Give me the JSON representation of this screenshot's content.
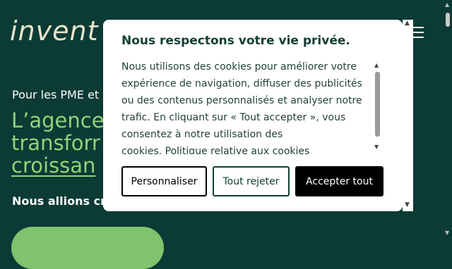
{
  "header": {
    "logo_text": "invent",
    "menu_icon": "hamburger-menu-icon"
  },
  "hero": {
    "subtitle": "Pour les PME et C",
    "title_lines": [
      "L’agence",
      "transforr",
      "croissan"
    ],
    "lead": "Nous allions cré"
  },
  "consent": {
    "title": "Nous respectons votre vie privée.",
    "body": "Nous utilisons des cookies pour améliorer votre expérience de navigation, diffuser des publicités ou des contenus personnalisés et analyser notre trafic. En cliquant sur « Tout accepter », vous consentez à notre utilisation des",
    "body_tail": "cookies.",
    "policy_link": "Politique relative aux cookies",
    "buttons": {
      "customize": "Personnaliser",
      "reject": "Tout rejeter",
      "accept": "Accepter tout"
    }
  },
  "colors": {
    "page_background": "#0b3b34",
    "headline_green": "#8fd47a",
    "modal_title": "#123d36",
    "accept_button": "#000000"
  }
}
